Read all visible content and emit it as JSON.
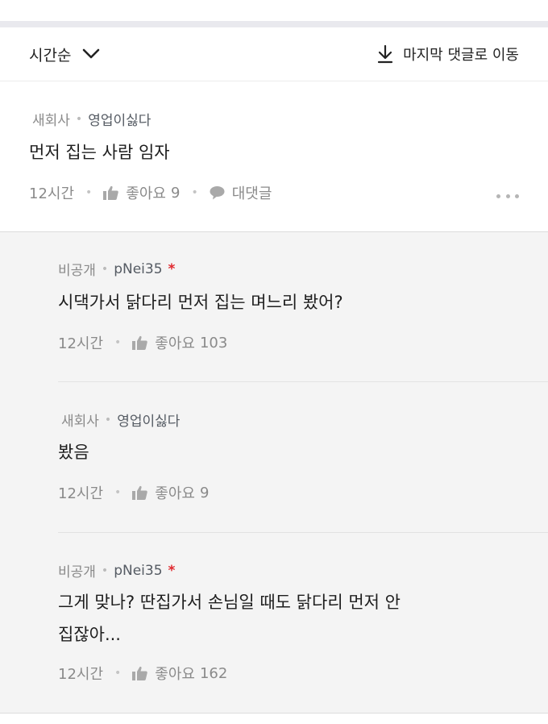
{
  "sort": {
    "label": "시간순"
  },
  "jump": {
    "label": "마지막 댓글로 이동"
  },
  "main_comment": {
    "company": "새회사",
    "nickname": "영업이싫다",
    "text": "먼저 집는 사람 임자",
    "time": "12시간",
    "like_label": "좋아요",
    "like_count": "9",
    "reply_label": "대댓글"
  },
  "replies": [
    {
      "company": "비공개",
      "nickname": "pNei35",
      "author_mark": "*",
      "text": "시댁가서 닭다리 먼저 집는 며느리 봤어?",
      "time": "12시간",
      "like_label": "좋아요",
      "like_count": "103"
    },
    {
      "company": "새회사",
      "nickname": "영업이싫다",
      "text": "봤음",
      "time": "12시간",
      "like_label": "좋아요",
      "like_count": "9"
    },
    {
      "company": "비공개",
      "nickname": "pNei35",
      "author_mark": "*",
      "text_line1": "그게 맞나? 딴집가서 손님일 때도 닭다리 먼저 안",
      "text_line2": "집잖아...",
      "time": "12시간",
      "like_label": "좋아요",
      "like_count": "162"
    }
  ],
  "colors": {
    "accent_star": "#e0282e",
    "reply_background": "#f4f4f4",
    "muted_text": "#8a8a8a"
  }
}
